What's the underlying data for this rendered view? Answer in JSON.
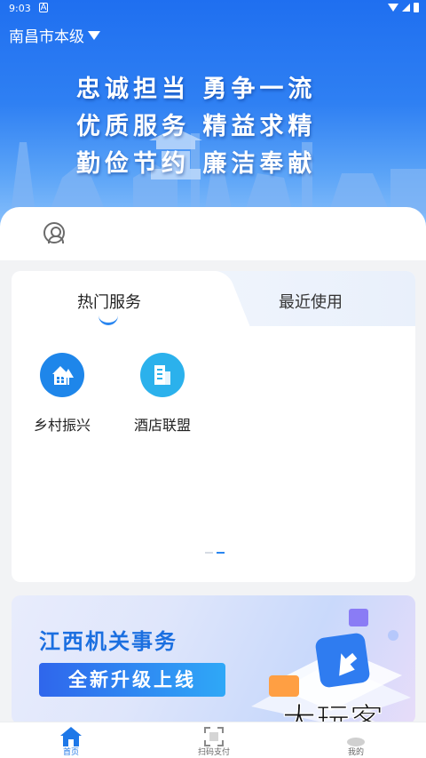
{
  "status_bar": {
    "time": "9:03",
    "notification_glyph": "A"
  },
  "header": {
    "city": "南昌市本级"
  },
  "banner": {
    "slogan_lines": [
      "忠诚担当 勇争一流",
      "优质服务 精益求精",
      "勤俭节约 廉洁奉献"
    ]
  },
  "services": {
    "tabs": [
      {
        "label": "热门服务"
      },
      {
        "label": "最近使用"
      }
    ],
    "items": [
      {
        "label": "乡村振兴",
        "icon": "house-tree-icon"
      },
      {
        "label": "酒店联盟",
        "icon": "building-icon"
      }
    ],
    "pager": {
      "pages": 2,
      "active": 2
    }
  },
  "promo": {
    "title": "江西机关事务",
    "subtitle": "全新升级上线"
  },
  "watermark": {
    "text": "大玩客"
  },
  "bottom_nav": [
    {
      "label": "首页",
      "icon": "home-icon",
      "active": true
    },
    {
      "label": "扫码支付",
      "icon": "scan-icon",
      "active": false
    },
    {
      "label": "我的",
      "icon": "profile-icon",
      "active": false
    }
  ],
  "colors": {
    "primary": "#1e78e8",
    "rural_icon_bg": "#1e86ea",
    "hotel_icon_bg": "#2bb1ec"
  }
}
